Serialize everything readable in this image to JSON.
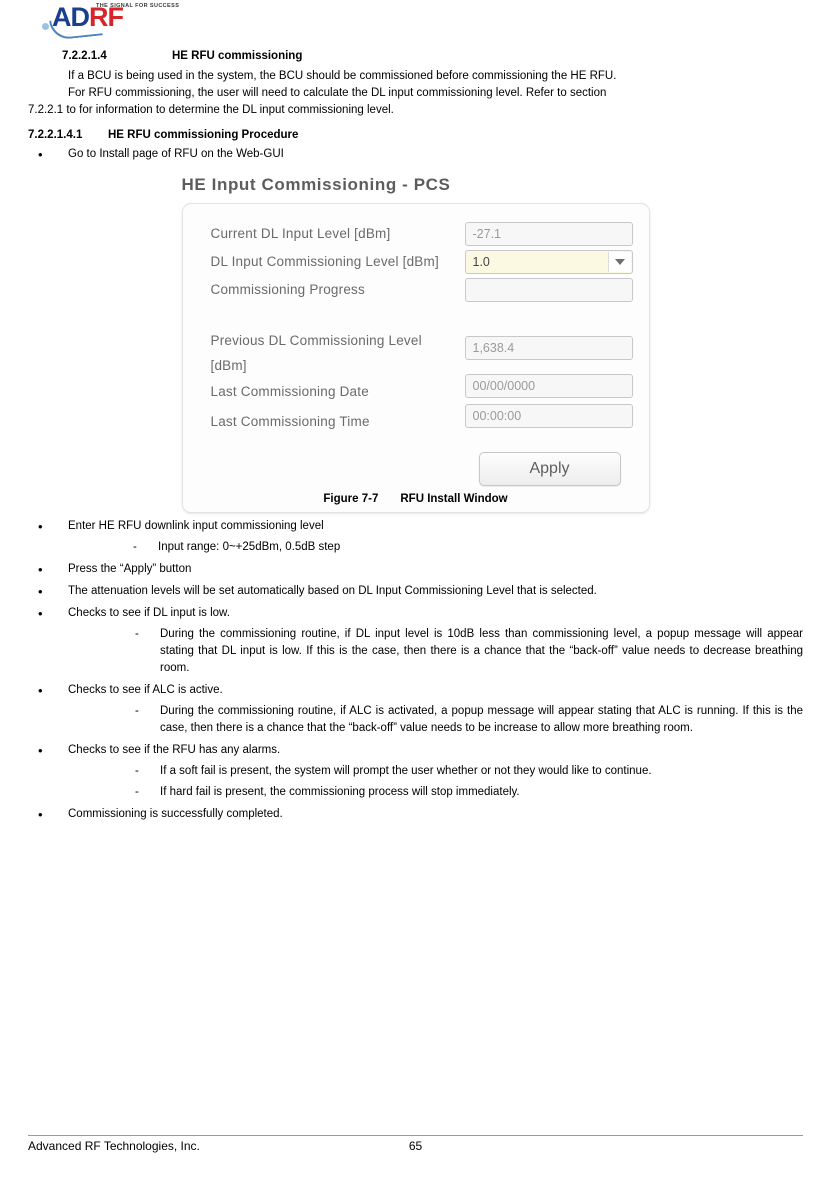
{
  "header": {
    "logo_letters": [
      "A",
      "D",
      "R",
      "F"
    ],
    "logo_tagline": "THE SIGNAL FOR SUCCESS"
  },
  "section": {
    "number": "7.2.2.1.4",
    "title": "HE RFU commissioning",
    "paragraph1": "If a BCU is being used in the system, the BCU should be commissioned before commissioning the HE RFU.",
    "paragraph2": "For RFU commissioning, the user will need to calculate the DL input commissioning level. Refer to section",
    "paragraph2_cont": "7.2.2.1 to for information to determine the DL input commissioning level.",
    "sub_number": "7.2.2.1.4.1",
    "sub_title": "HE RFU commissioning Procedure"
  },
  "bullets": {
    "b1": "Go to Install page of RFU on the Web-GUI",
    "b2": "Enter HE RFU downlink input commissioning level",
    "b2_sub1": "Input range: 0~+25dBm, 0.5dB step",
    "b3": "Press the “Apply” button",
    "b4": "The attenuation levels will be set automatically based on DL Input Commissioning Level that is selected.",
    "b5": "Checks to see if DL input is low.",
    "b5_sub1": "During the commissioning routine, if DL input level is 10dB less than commissioning level, a popup message will appear stating that DL input is low. If this is the case, then there is a chance that the “back-off” value needs to decrease breathing room.",
    "b6": "Checks to see if ALC is active.",
    "b6_sub1": "During the commissioning routine, if ALC is activated, a popup message will appear stating that ALC is running.  If this is the case, then there is a chance that the “back-off” value needs to be increase to allow more breathing room.",
    "b7": "Checks to see if the RFU has any alarms.",
    "b7_sub1": "If a soft fail is present, the system will prompt the user whether or not they would like to continue.",
    "b7_sub2": "If hard fail is present, the commissioning process will stop immediately.",
    "b8": "Commissioning is successfully completed."
  },
  "figure": {
    "panel_title": "HE Input Commissioning - PCS",
    "fields": [
      {
        "label": "Current DL Input Level [dBm]",
        "value": "-27.1",
        "type": "readonly"
      },
      {
        "label": "DL Input Commissioning Level [dBm]",
        "value": "1.0",
        "type": "combo"
      },
      {
        "label": "Commissioning Progress",
        "value": "",
        "type": "readonly"
      },
      {
        "label": "Previous DL Commissioning Level [dBm]",
        "value": "1,638.4",
        "type": "readonly"
      },
      {
        "label": "Last Commissioning Date",
        "value": "00/00/0000",
        "type": "readonly"
      },
      {
        "label": "Last Commissioning Time",
        "value": "00:00:00",
        "type": "readonly"
      }
    ],
    "apply_button": "Apply",
    "caption_label": "Figure 7-7",
    "caption_title": "RFU Install Window"
  },
  "footer": {
    "company": "Advanced RF Technologies, Inc.",
    "page_number": "65"
  }
}
